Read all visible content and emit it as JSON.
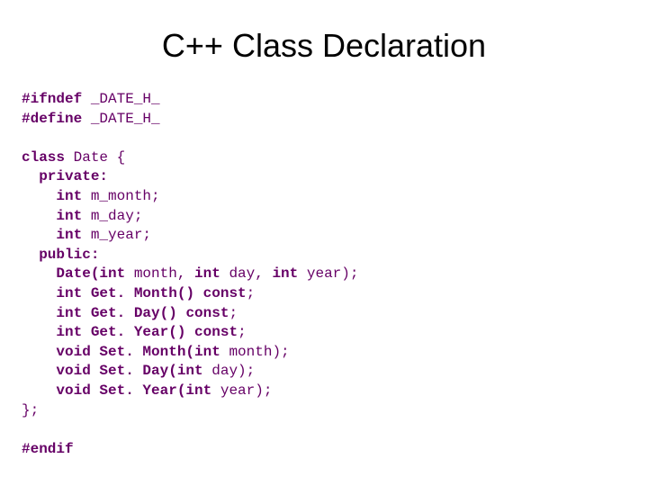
{
  "title": "C++ Class Declaration",
  "code": {
    "l1a": "#ifndef",
    "l1b": " _DATE_H_",
    "l2a": "#define",
    "l2b": " _DATE_H_",
    "l3a": "class",
    "l3b": " Date {",
    "l4a": "  private:",
    "l5a": "    int",
    "l5b": " m_month;",
    "l6a": "    int",
    "l6b": " m_day;",
    "l7a": "    int",
    "l7b": " m_year;",
    "l8a": "  public:",
    "l9a": "    Date(int",
    "l9b": " month, ",
    "l9c": "int",
    "l9d": " day, ",
    "l9e": "int",
    "l9f": " year);",
    "l10a": "    int",
    "l10b": " Get. Month() ",
    "l10c": "const",
    "l10d": ";",
    "l11a": "    int",
    "l11b": " Get. Day() ",
    "l11c": "const",
    "l11d": ";",
    "l12a": "    int",
    "l12b": " Get. Year() ",
    "l12c": "const",
    "l12d": ";",
    "l13a": "    void",
    "l13b": " Set. Month(int",
    "l13c": " month);",
    "l14a": "    void",
    "l14b": " Set. Day(int",
    "l14c": " day);",
    "l15a": "    void",
    "l15b": " Set. Year(int",
    "l15c": " year);",
    "l16": "};",
    "l17": "#endif"
  }
}
